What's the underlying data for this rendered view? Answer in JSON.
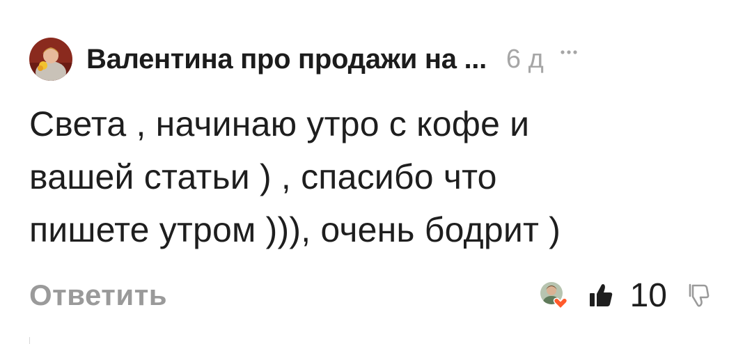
{
  "comment": {
    "author": "Валентина про продажи на ...",
    "time": "6 д",
    "text": "Света , начинаю утро с кофе и\nвашей статьи ) , спасибо что\nпишете утром ))), очень бодрит )",
    "reply_label": "Ответить",
    "like_count": "10"
  },
  "icons": {
    "more": "more-dots-icon",
    "like": "thumbs-up-icon",
    "dislike": "thumbs-down-icon",
    "liker_reaction": "heart-icon"
  },
  "colors": {
    "muted": "#a6a6a6",
    "heart": "#ff5a2b",
    "text": "#1e1e1e"
  }
}
